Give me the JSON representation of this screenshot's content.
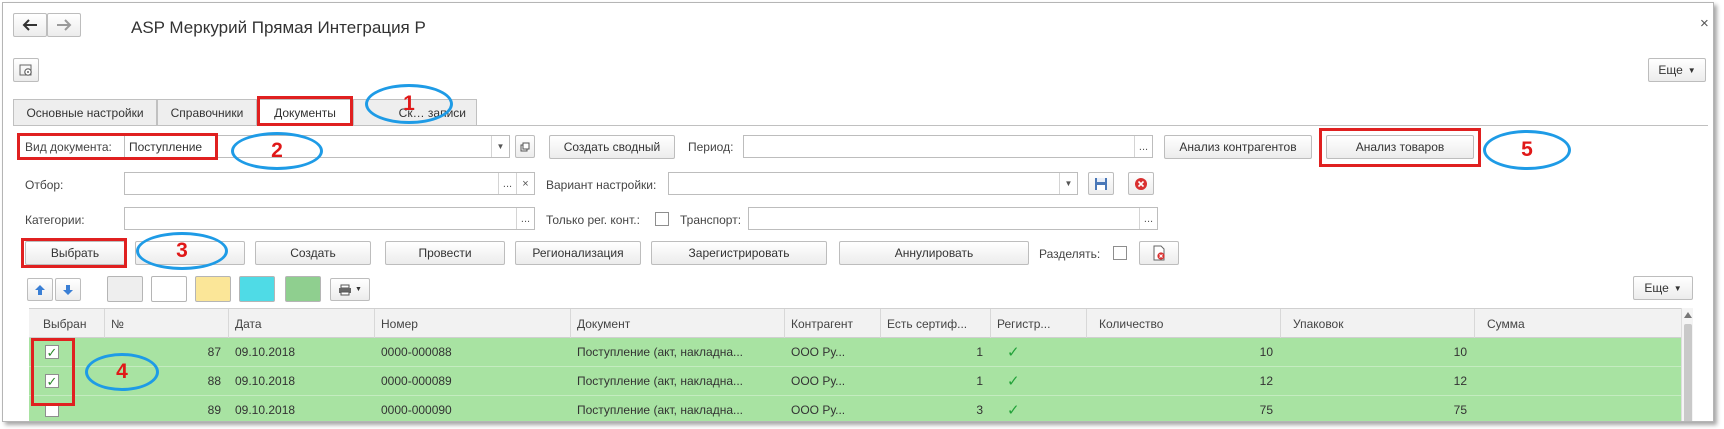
{
  "window": {
    "title": "ASP Меркурий Прямая Интеграция Р",
    "more_label": "Еще",
    "back_icon": "arrow-left-icon",
    "forward_icon": "arrow-right-icon",
    "close_icon": "close-icon"
  },
  "tabs": [
    {
      "label": "Основные настройки"
    },
    {
      "label": "Справочники"
    },
    {
      "label": "Документы"
    },
    {
      "label": "Ск… записи"
    }
  ],
  "form": {
    "doc_type_label": "Вид документа:",
    "doc_type_value": "Поступление",
    "create_summary_label": "Создать сводный",
    "period_label": "Период:",
    "period_value": "",
    "analyze_counterparties_label": "Анализ контрагентов",
    "analyze_goods_label": "Анализ товаров",
    "filter_label": "Отбор:",
    "filter_value": "",
    "variant_label": "Вариант настройки:",
    "variant_value": "",
    "categories_label": "Категории:",
    "categories_value": "",
    "only_reg_label": "Только рег. конт.:",
    "transport_label": "Транспорт:",
    "transport_value": "",
    "dots": "...",
    "clear_x": "×"
  },
  "toolbar": {
    "select_label": "Выбрать",
    "create_label": "Создать",
    "post_label": "Провести",
    "regionalize_label": "Регионализация",
    "register_label": "Зарегистрировать",
    "cancel_label": "Аннулировать",
    "split_label": "Разделять:",
    "grid_more_label": "Еще"
  },
  "swatch_colors": [
    "#eeeeee",
    "#ffffff",
    "#fbe698",
    "#4fdbe6",
    "#8fcf8f"
  ],
  "table": {
    "columns": [
      "Выбран",
      "№",
      "Дата",
      "Номер",
      "Документ",
      "Контрагент",
      "Есть сертиф...",
      "Регистр...",
      "Количество",
      "Упаковок",
      "Сумма"
    ],
    "rows": [
      {
        "selected": true,
        "num": "87",
        "date": "09.10.2018",
        "number": "0000-000088",
        "document": "Поступление (акт, накладна...",
        "counterparty": "ООО Ру...",
        "cert": "1",
        "registered": "✓",
        "qty": "10",
        "packs": "10",
        "sum": ""
      },
      {
        "selected": true,
        "num": "88",
        "date": "09.10.2018",
        "number": "0000-000089",
        "document": "Поступление (акт, накладна...",
        "counterparty": "ООО Ру...",
        "cert": "1",
        "registered": "✓",
        "qty": "12",
        "packs": "12",
        "sum": ""
      },
      {
        "selected": false,
        "num": "89",
        "date": "09.10.2018",
        "number": "0000-000090",
        "document": "Поступление (акт, накладна...",
        "counterparty": "ООО Ру...",
        "cert": "3",
        "registered": "✓",
        "qty": "75",
        "packs": "75",
        "sum": ""
      }
    ]
  },
  "annotations": [
    "1",
    "2",
    "3",
    "4",
    "5"
  ],
  "colors": {
    "row_green": "#a8e3a2",
    "annotation_red": "#e02020",
    "annotation_blue": "#1e9be6"
  }
}
